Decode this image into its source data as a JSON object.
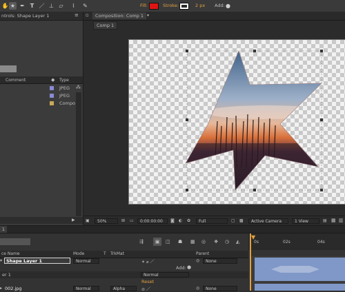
{
  "toolbar": {
    "fill_label": "Fill:",
    "stroke_label": "Stroke:",
    "stroke_width": "2 px",
    "add_label": "Add:",
    "fill_color": "#e01414",
    "stroke_color": "#ffffff"
  },
  "project": {
    "panel_title": "ntrols: Shape Layer 1",
    "col_comment": "Comment",
    "col_type": "Type",
    "items": [
      {
        "type": "JPEG",
        "color": "#8a8ad8"
      },
      {
        "type": "JPEG",
        "color": "#8a8ad8"
      },
      {
        "type": "Compo",
        "color": "#c9a85a"
      }
    ]
  },
  "composition": {
    "tab_title": "Composition: Comp 1",
    "sub_tab": "Comp 1"
  },
  "viewer_bar": {
    "zoom": "50%",
    "timecode": "0:00:00:00",
    "resolution": "Full",
    "camera": "Active Camera",
    "views": "1 View"
  },
  "timeline": {
    "tab_number": "1",
    "col_source": "ce Name",
    "col_mode": "Mode",
    "col_t": "T",
    "col_trkmat": "TrkMat",
    "col_parent": "Parent",
    "ruler_start": "0s",
    "ruler_02": "02s",
    "ruler_04": "04s",
    "layer1_name": "Shape Layer 1",
    "layer1_mode": "Normal",
    "layer1_parent": "None",
    "add_label": "Add:",
    "group_label": "er 1",
    "group_mode": "Normal",
    "reset_label": "Reset",
    "layer2_name": "002.jpg",
    "layer2_mode": "Normal",
    "layer2_trkmat": "Alpha",
    "layer2_parent": "None"
  }
}
